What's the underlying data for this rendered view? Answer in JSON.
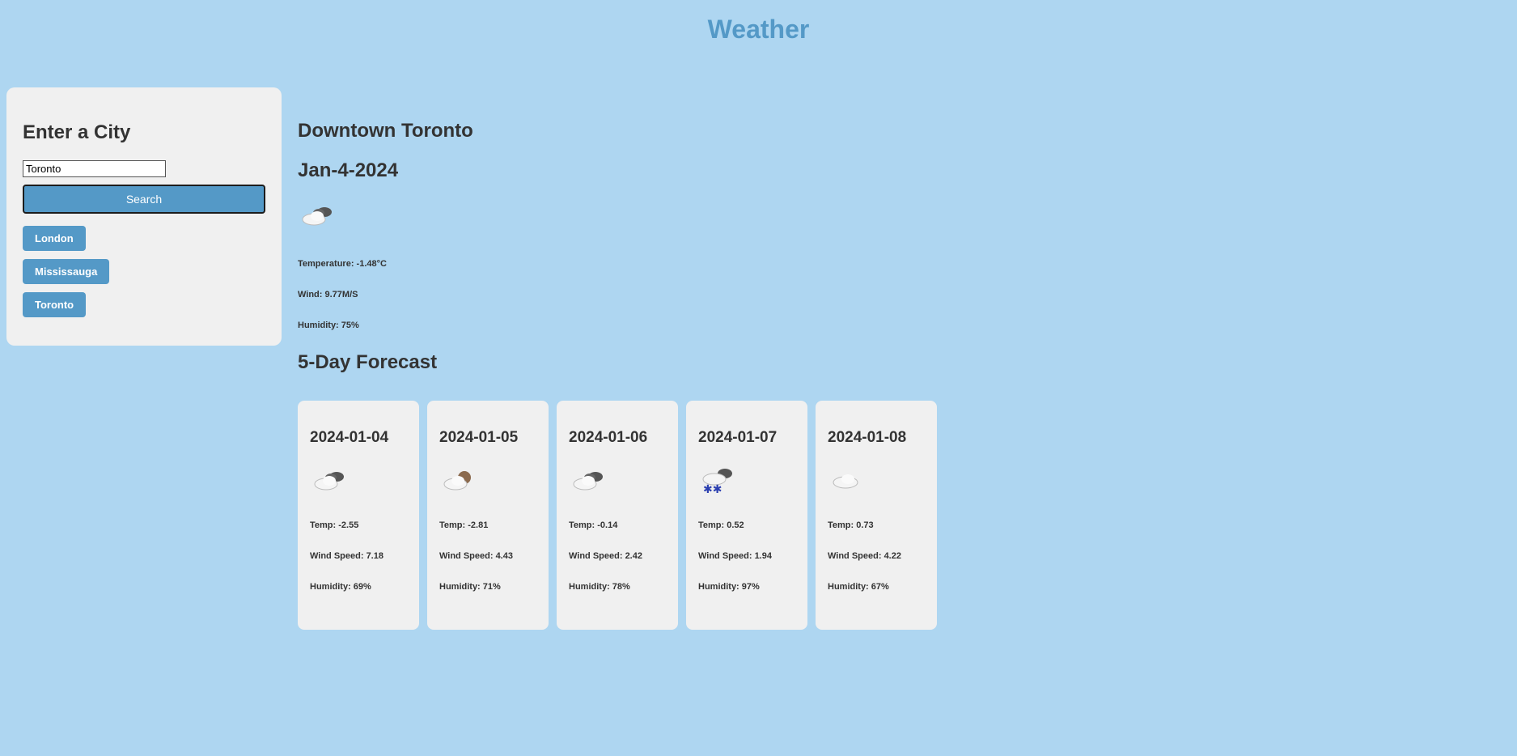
{
  "app": {
    "title": "Weather"
  },
  "sidebar": {
    "heading": "Enter a City",
    "input_value": "Toronto",
    "search_label": "Search",
    "history": [
      "London",
      "Mississauga",
      "Toronto"
    ]
  },
  "current": {
    "city": "Downtown Toronto",
    "date": "Jan-4-2024",
    "icon": "cloudy-icon",
    "temperature": "Temperature: -1.48°C",
    "wind": "Wind: 9.77M/S",
    "humidity": "Humidity: 75%"
  },
  "forecast": {
    "heading": "5-Day Forecast",
    "days": [
      {
        "date": "2024-01-04",
        "icon": "cloudy-icon",
        "temp": "Temp: -2.55",
        "wind": "Wind Speed: 7.18",
        "humidity": "Humidity: 69%"
      },
      {
        "date": "2024-01-05",
        "icon": "partly-cloudy-icon",
        "temp": "Temp: -2.81",
        "wind": "Wind Speed: 4.43",
        "humidity": "Humidity: 71%"
      },
      {
        "date": "2024-01-06",
        "icon": "cloudy-icon",
        "temp": "Temp: -0.14",
        "wind": "Wind Speed: 2.42",
        "humidity": "Humidity: 78%"
      },
      {
        "date": "2024-01-07",
        "icon": "snow-icon",
        "temp": "Temp: 0.52",
        "wind": "Wind Speed: 1.94",
        "humidity": "Humidity: 97%"
      },
      {
        "date": "2024-01-08",
        "icon": "cloud-icon",
        "temp": "Temp: 0.73",
        "wind": "Wind Speed: 4.22",
        "humidity": "Humidity: 67%"
      }
    ]
  },
  "colors": {
    "background": "#aed6f1",
    "accent": "#5499c7",
    "card": "#f0f0f0"
  }
}
